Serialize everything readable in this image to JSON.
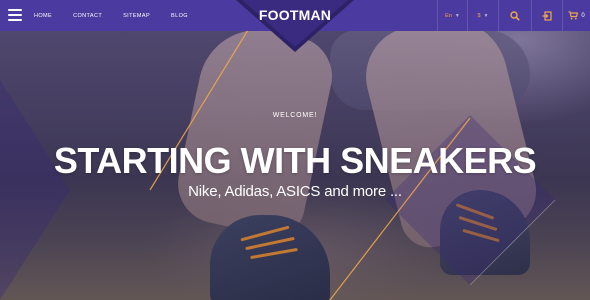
{
  "header": {
    "nav": [
      {
        "label": "HOME"
      },
      {
        "label": "CONTACT"
      },
      {
        "label": "SITEMAP"
      },
      {
        "label": "BLOG"
      }
    ],
    "logo": "FOOTMAN",
    "language": {
      "value": "En",
      "icon": "chevron-down-icon"
    },
    "currency": {
      "value": "$",
      "icon": "chevron-down-icon"
    },
    "search_icon": "search-icon",
    "login_icon": "login-icon",
    "cart": {
      "icon": "cart-icon",
      "count": "0"
    }
  },
  "hero": {
    "welcome": "WELCOME!",
    "headline": "STARTING WITH SNEAKERS",
    "subline": "Nike, Adidas, ASICS and more ..."
  },
  "colors": {
    "header_bg": "#4b3aa0",
    "accent": "#f0a64a",
    "text": "#ffffff"
  }
}
